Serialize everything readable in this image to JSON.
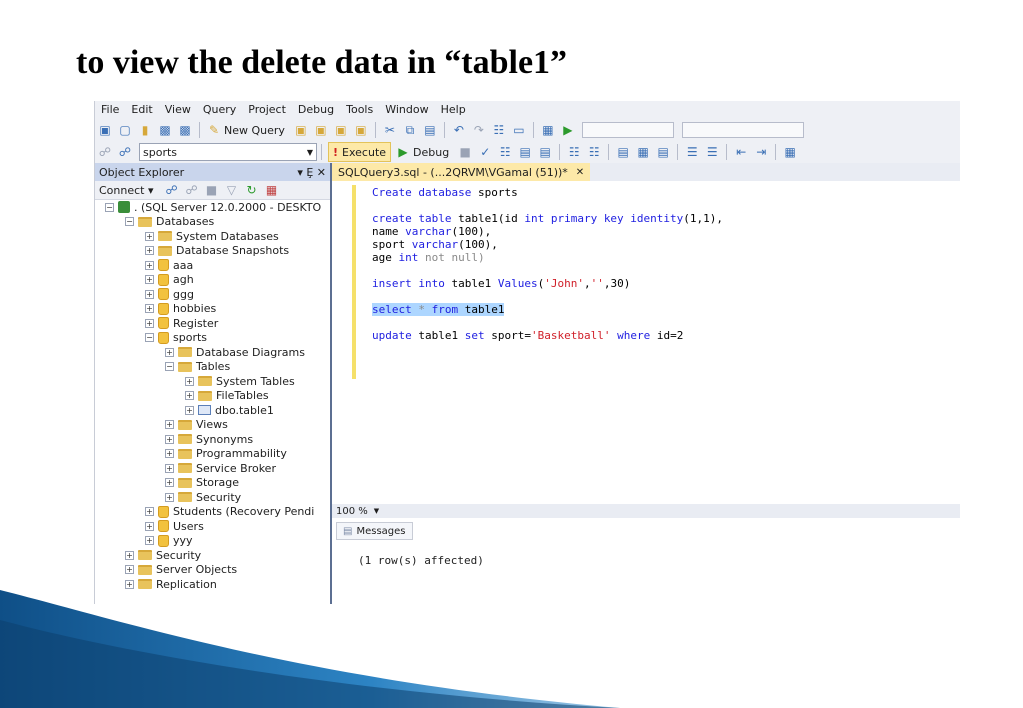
{
  "slide": {
    "title": "to view the delete data in “table1”"
  },
  "menu": [
    "File",
    "Edit",
    "View",
    "Query",
    "Project",
    "Debug",
    "Tools",
    "Window",
    "Help"
  ],
  "toolbar": {
    "new_query": "New Query",
    "database": "sports",
    "execute": "Execute",
    "debug": "Debug"
  },
  "object_explorer": {
    "title": "Object Explorer",
    "pin": "▾ Ȩ ✕",
    "connect": "Connect ▾",
    "tree": [
      {
        "label": ". (SQL Server 12.0.2000 - DESKTO",
        "exp": "−",
        "indent": 0,
        "icon": "server"
      },
      {
        "label": "Databases",
        "exp": "−",
        "indent": 1,
        "icon": "folder"
      },
      {
        "label": "System Databases",
        "exp": "+",
        "indent": 2,
        "icon": "folder"
      },
      {
        "label": "Database Snapshots",
        "exp": "+",
        "indent": 2,
        "icon": "folder"
      },
      {
        "label": "aaa",
        "exp": "+",
        "indent": 2,
        "icon": "db"
      },
      {
        "label": "agh",
        "exp": "+",
        "indent": 2,
        "icon": "db"
      },
      {
        "label": "ggg",
        "exp": "+",
        "indent": 2,
        "icon": "db"
      },
      {
        "label": "hobbies",
        "exp": "+",
        "indent": 2,
        "icon": "db"
      },
      {
        "label": "Register",
        "exp": "+",
        "indent": 2,
        "icon": "db"
      },
      {
        "label": "sports",
        "exp": "−",
        "indent": 2,
        "icon": "db"
      },
      {
        "label": "Database Diagrams",
        "exp": "+",
        "indent": 3,
        "icon": "folder"
      },
      {
        "label": "Tables",
        "exp": "−",
        "indent": 3,
        "icon": "folder"
      },
      {
        "label": "System Tables",
        "exp": "+",
        "indent": 4,
        "icon": "folder"
      },
      {
        "label": "FileTables",
        "exp": "+",
        "indent": 4,
        "icon": "folder"
      },
      {
        "label": "dbo.table1",
        "exp": "+",
        "indent": 4,
        "icon": "table"
      },
      {
        "label": "Views",
        "exp": "+",
        "indent": 3,
        "icon": "folder"
      },
      {
        "label": "Synonyms",
        "exp": "+",
        "indent": 3,
        "icon": "folder"
      },
      {
        "label": "Programmability",
        "exp": "+",
        "indent": 3,
        "icon": "folder"
      },
      {
        "label": "Service Broker",
        "exp": "+",
        "indent": 3,
        "icon": "folder"
      },
      {
        "label": "Storage",
        "exp": "+",
        "indent": 3,
        "icon": "folder"
      },
      {
        "label": "Security",
        "exp": "+",
        "indent": 3,
        "icon": "folder"
      },
      {
        "label": "Students (Recovery Pendi",
        "exp": "+",
        "indent": 2,
        "icon": "db"
      },
      {
        "label": "Users",
        "exp": "+",
        "indent": 2,
        "icon": "db"
      },
      {
        "label": "yyy",
        "exp": "+",
        "indent": 2,
        "icon": "db"
      },
      {
        "label": "Security",
        "exp": "+",
        "indent": 1,
        "icon": "folder"
      },
      {
        "label": "Server Objects",
        "exp": "+",
        "indent": 1,
        "icon": "folder"
      },
      {
        "label": "Replication",
        "exp": "+",
        "indent": 1,
        "icon": "folder"
      }
    ]
  },
  "editor": {
    "tab": "SQLQuery3.sql - (...2QRVM\\VGamal (51))*",
    "tab_close": "✕",
    "lines": {
      "l1_kw": "Create database",
      "l1_rest": " sports",
      "l2_kw": "create table",
      "l2_rest": " table1(id ",
      "l2_kw2": "int primary key identity",
      "l2_rest2": "(1,1),",
      "l3_a": "name ",
      "l3_kw": "varchar",
      "l3_b": "(100),",
      "l4_a": "sport ",
      "l4_kw": "varchar",
      "l4_b": "(100),",
      "l5_a": "age ",
      "l5_kw": "int",
      "l5_gray": " not null)",
      "l6_kw": "insert into",
      "l6_a": " table1 ",
      "l6_kw2": "Values",
      "l6_b": "(",
      "l6_str": "'John'",
      "l6_c": ",",
      "l6_str2": "''",
      "l6_d": ",30)",
      "l7_kw": "select",
      "l7_gray": " * ",
      "l7_kw2": "from",
      "l7_rest": " table1",
      "l8_kw": "update",
      "l8_a": " table1 ",
      "l8_kw2": "set",
      "l8_b": " sport=",
      "l8_str": "'Basketball'",
      "l8_kw3": " where",
      "l8_c": " id=2"
    }
  },
  "zoom": "100 %",
  "results": {
    "tab": "Messages",
    "message": "(1 row(s) affected)"
  },
  "colors": {
    "accent": "#1f6fa7",
    "highlight": "#fde9a8",
    "selection": "#add6ff"
  }
}
